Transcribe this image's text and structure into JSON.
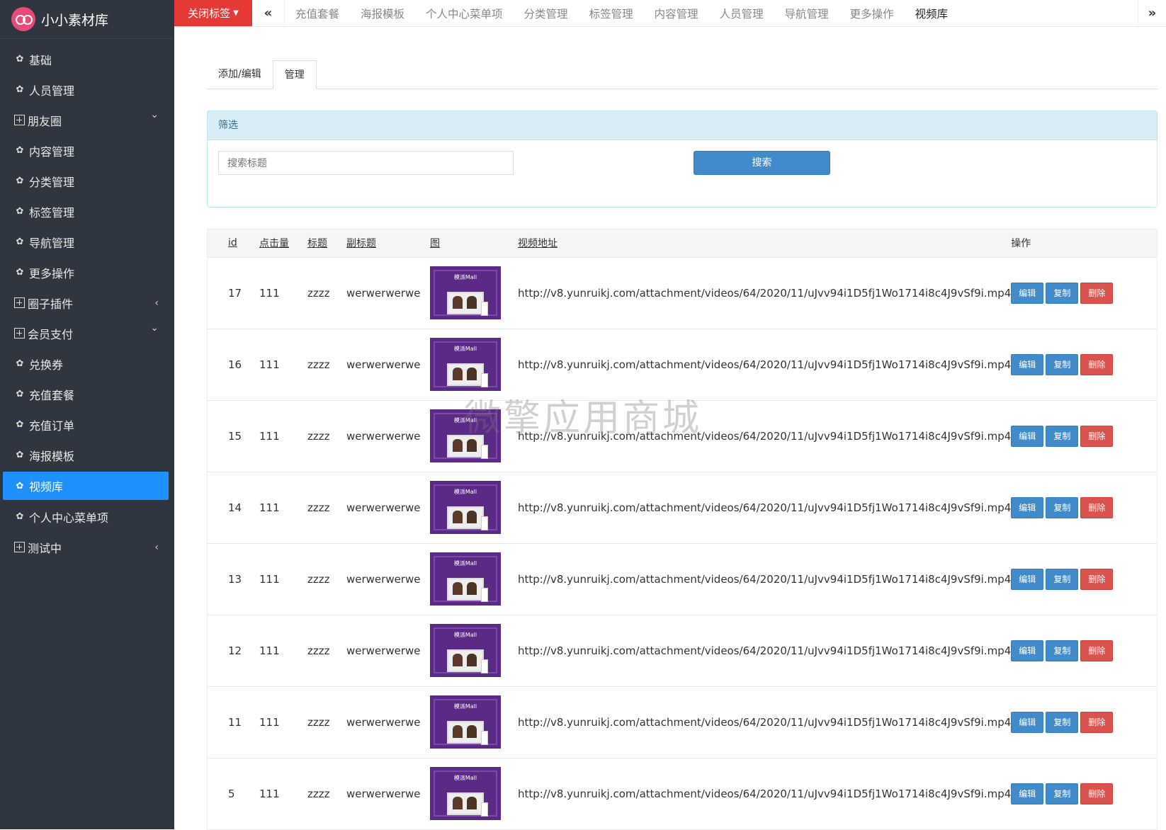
{
  "app": {
    "name": "小小素材库"
  },
  "sidebar": {
    "items": [
      {
        "label": "基础",
        "type": "leaf"
      },
      {
        "label": "人员管理",
        "type": "leaf"
      },
      {
        "label": "朋友圈",
        "type": "group",
        "chevron": "down"
      },
      {
        "label": "内容管理",
        "type": "leaf"
      },
      {
        "label": "分类管理",
        "type": "leaf"
      },
      {
        "label": "标签管理",
        "type": "leaf"
      },
      {
        "label": "导航管理",
        "type": "leaf"
      },
      {
        "label": "更多操作",
        "type": "leaf"
      },
      {
        "label": "圈子插件",
        "type": "group",
        "chevron": "left"
      },
      {
        "label": "会员支付",
        "type": "group",
        "chevron": "down"
      },
      {
        "label": "兑换券",
        "type": "leaf"
      },
      {
        "label": "充值套餐",
        "type": "leaf"
      },
      {
        "label": "充值订单",
        "type": "leaf"
      },
      {
        "label": "海报模板",
        "type": "leaf"
      },
      {
        "label": "视频库",
        "type": "leaf",
        "active": true
      },
      {
        "label": "个人中心菜单项",
        "type": "leaf"
      },
      {
        "label": "测试中",
        "type": "group",
        "chevron": "left"
      }
    ]
  },
  "topbar": {
    "close_label": "关闭标签",
    "tabs": [
      "充值套餐",
      "海报模板",
      "个人中心菜单项",
      "分类管理",
      "标签管理",
      "内容管理",
      "人员管理",
      "导航管理",
      "更多操作",
      "视频库"
    ],
    "current_tab": "视频库"
  },
  "subtabs": {
    "add_edit": "添加/编辑",
    "manage": "管理"
  },
  "filter": {
    "heading": "筛选",
    "placeholder": "搜索标题",
    "button": "搜索"
  },
  "table": {
    "columns": {
      "id": "id",
      "clicks": "点击量",
      "title": "标题",
      "subtitle": "副标题",
      "image": "图",
      "video_url": "视频地址",
      "actions": "操作"
    },
    "thumb_caption": "模派Mall",
    "actions": {
      "edit": "编辑",
      "copy": "复制",
      "delete": "删除"
    },
    "rows": [
      {
        "id": "17",
        "clicks": "111",
        "title": "zzzz",
        "subtitle": "werwerwerwe",
        "url": "http://v8.yunruikj.com/attachment/videos/64/2020/11/uJvv94i1D5fj1Wo1714i8c4J9vSf9i.mp4"
      },
      {
        "id": "16",
        "clicks": "111",
        "title": "zzzz",
        "subtitle": "werwerwerwe",
        "url": "http://v8.yunruikj.com/attachment/videos/64/2020/11/uJvv94i1D5fj1Wo1714i8c4J9vSf9i.mp4"
      },
      {
        "id": "15",
        "clicks": "111",
        "title": "zzzz",
        "subtitle": "werwerwerwe",
        "url": "http://v8.yunruikj.com/attachment/videos/64/2020/11/uJvv94i1D5fj1Wo1714i8c4J9vSf9i.mp4"
      },
      {
        "id": "14",
        "clicks": "111",
        "title": "zzzz",
        "subtitle": "werwerwerwe",
        "url": "http://v8.yunruikj.com/attachment/videos/64/2020/11/uJvv94i1D5fj1Wo1714i8c4J9vSf9i.mp4"
      },
      {
        "id": "13",
        "clicks": "111",
        "title": "zzzz",
        "subtitle": "werwerwerwe",
        "url": "http://v8.yunruikj.com/attachment/videos/64/2020/11/uJvv94i1D5fj1Wo1714i8c4J9vSf9i.mp4"
      },
      {
        "id": "12",
        "clicks": "111",
        "title": "zzzz",
        "subtitle": "werwerwerwe",
        "url": "http://v8.yunruikj.com/attachment/videos/64/2020/11/uJvv94i1D5fj1Wo1714i8c4J9vSf9i.mp4"
      },
      {
        "id": "11",
        "clicks": "111",
        "title": "zzzz",
        "subtitle": "werwerwerwe",
        "url": "http://v8.yunruikj.com/attachment/videos/64/2020/11/uJvv94i1D5fj1Wo1714i8c4J9vSf9i.mp4"
      },
      {
        "id": "5",
        "clicks": "111",
        "title": "zzzz",
        "subtitle": "werwerwerwe",
        "url": "http://v8.yunruikj.com/attachment/videos/64/2020/11/uJvv94i1D5fj1Wo1714i8c4J9vSf9i.mp4"
      }
    ]
  },
  "watermark": "微擎应用商城",
  "colors": {
    "sidebar_bg": "#2f3640",
    "active_blue": "#1e90ff",
    "close_red": "#e53935",
    "btn_blue": "#428bca",
    "btn_red": "#d9534f"
  }
}
